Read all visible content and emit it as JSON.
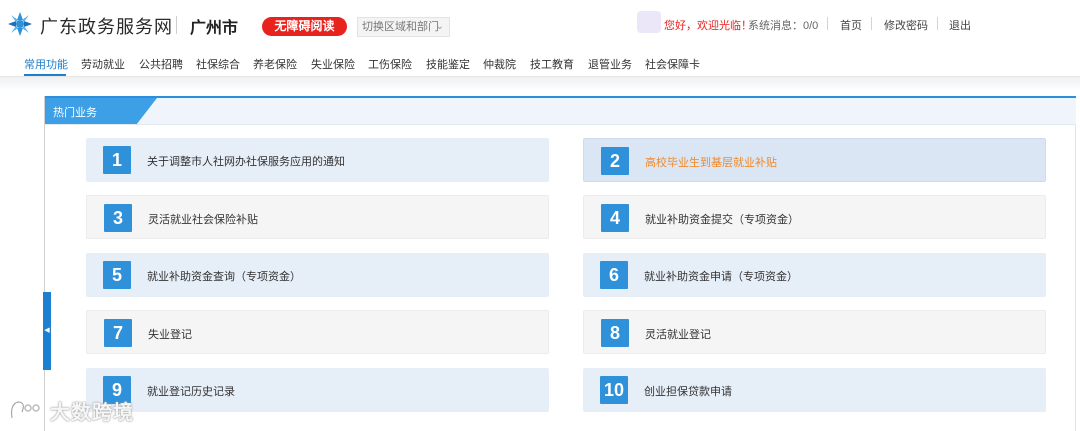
{
  "header": {
    "site_name": "广东政务服务网",
    "city": "广州市",
    "barrier_free": "无障碍阅读",
    "switch_region": "切换区域和部门",
    "welcome": "您好，欢迎光临！",
    "system_message": "系统消息：0/0",
    "links": [
      "首页",
      "修改密码",
      "退出"
    ]
  },
  "nav": {
    "items": [
      "常用功能",
      "劳动就业",
      "公共招聘",
      "社保综合",
      "养老保险",
      "失业保险",
      "工伤保险",
      "技能鉴定",
      "仲裁院",
      "技工教育",
      "退管业务",
      "社会保障卡"
    ],
    "active": "常用功能"
  },
  "panel": {
    "title": "热门业务",
    "items": [
      {
        "num": "1",
        "label": "关于调整市人社网办社保服务应用的通知"
      },
      {
        "num": "2",
        "label": "高校毕业生到基层就业补贴"
      },
      {
        "num": "3",
        "label": "灵活就业社会保险补贴"
      },
      {
        "num": "4",
        "label": "就业补助资金提交（专项资金）"
      },
      {
        "num": "5",
        "label": "就业补助资金查询（专项资金）"
      },
      {
        "num": "6",
        "label": "就业补助资金申请（专项资金）"
      },
      {
        "num": "7",
        "label": "失业登记"
      },
      {
        "num": "8",
        "label": "灵活就业登记"
      },
      {
        "num": "9",
        "label": "就业登记历史记录"
      },
      {
        "num": "10",
        "label": "创业担保贷款申请"
      }
    ]
  },
  "watermark": "大数跨境",
  "colors": {
    "accent": "#1d7fd0",
    "badge": "#2e91d9",
    "alert": "#e8221d",
    "highlight_text": "#f0892a"
  },
  "icons": {
    "logo": "gov-logo-icon",
    "chevron": "chevron-down-icon",
    "toggle": "chevron-left-icon"
  }
}
